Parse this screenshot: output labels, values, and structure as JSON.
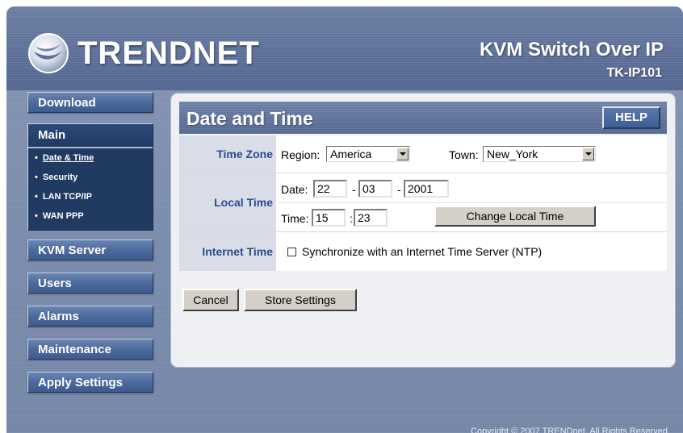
{
  "header": {
    "logo_text": "TRENDNET",
    "product_title": "KVM Switch Over IP",
    "model": "TK-IP101"
  },
  "sidebar": {
    "download": "Download",
    "main": {
      "label": "Main",
      "items": [
        {
          "label": "Date & Time",
          "active": true
        },
        {
          "label": "Security"
        },
        {
          "label": "LAN TCP/IP"
        },
        {
          "label": "WAN PPP"
        }
      ]
    },
    "kvm_server": "KVM Server",
    "users": "Users",
    "alarms": "Alarms",
    "maintenance": "Maintenance",
    "apply_settings": "Apply Settings"
  },
  "panel": {
    "title": "Date and Time",
    "help": "HELP"
  },
  "time_zone": {
    "label": "Time Zone",
    "region_label": "Region:",
    "region_value": "America",
    "town_label": "Town:",
    "town_value": "New_York"
  },
  "local_time": {
    "label": "Local Time",
    "date_label": "Date:",
    "day": "22",
    "month": "03",
    "year": "2001",
    "dash": "-",
    "time_label": "Time:",
    "hour": "15",
    "minute": "23",
    "colon": ":",
    "change_button": "Change Local Time"
  },
  "internet_time": {
    "label": "Internet Time",
    "checkbox_label": "Synchronize with an Internet Time Server (NTP)",
    "checked": false
  },
  "actions": {
    "cancel": "Cancel",
    "store": "Store Settings"
  },
  "footer": {
    "copyright": "Copyright © 2007 TRENDnet. All Rights Reserved."
  }
}
